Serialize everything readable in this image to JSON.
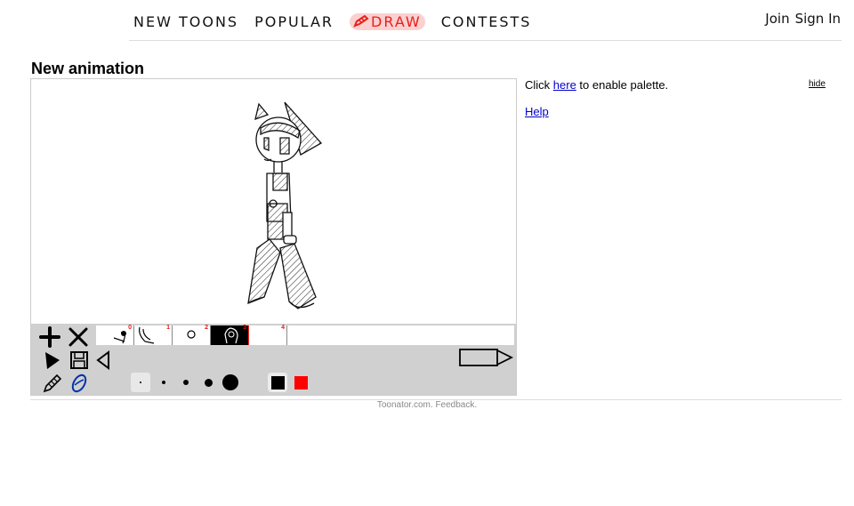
{
  "nav": {
    "items": [
      {
        "label": "New toons"
      },
      {
        "label": "Popular"
      },
      {
        "label": "Draw"
      },
      {
        "label": "Contests"
      }
    ],
    "auth": {
      "join": "Join",
      "sign_in": "Sign In"
    }
  },
  "page": {
    "title": "New animation"
  },
  "editor": {
    "frames": [
      {
        "number": "0",
        "active": false
      },
      {
        "number": "1",
        "active": false
      },
      {
        "number": "2",
        "active": false
      },
      {
        "number": "3",
        "active": true
      },
      {
        "number": "4",
        "active": false
      }
    ],
    "tools": {
      "add_frame": "plus-icon",
      "delete_frame": "x-icon",
      "play": "play-icon",
      "save": "floppy-icon",
      "prev": "triangle-left-icon",
      "pencil": "pencil-icon",
      "eraser": "eraser-icon",
      "next_frame": "next-frame-icon"
    },
    "brush_sizes": [
      "1",
      "2",
      "3",
      "4",
      "5"
    ],
    "selected_brush": "1",
    "colors": [
      "#000000",
      "#ff0000"
    ],
    "selected_color": "#000000"
  },
  "side": {
    "click_prefix": "Click ",
    "here_link": "here",
    "click_suffix": " to enable palette.",
    "help": "Help",
    "hide": "hide"
  },
  "footer": {
    "site": "Toonator.com.",
    "feedback": "Feedback."
  },
  "colors": {
    "accent": "#e8201a",
    "link": "#0000cc",
    "toolbar": "#d0d0d0"
  }
}
